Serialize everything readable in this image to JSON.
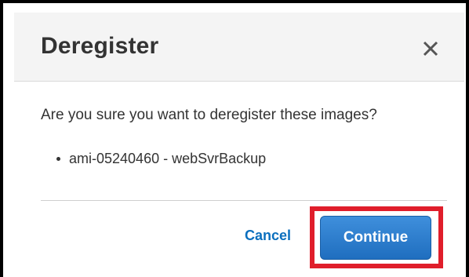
{
  "dialog": {
    "title": "Deregister",
    "close_icon": "close-icon",
    "message": "Are you sure you want to deregister these images?",
    "images": [
      "ami-05240460 - webSvrBackup"
    ],
    "cancel_label": "Cancel",
    "continue_label": "Continue"
  },
  "colors": {
    "header_bg": "#f4f4f4",
    "link": "#0b6fbe",
    "primary_button": "#2b7bcc",
    "highlight": "#e01e2b"
  }
}
